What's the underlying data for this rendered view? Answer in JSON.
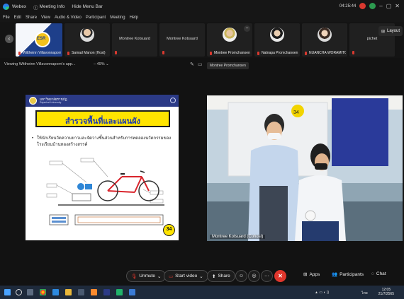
{
  "titlebar": {
    "app": "Webex",
    "meeting_info": "Meeting Info",
    "menu_toggle": "Hide Menu Bar",
    "time": "04:25:44"
  },
  "menu": {
    "items": [
      "File",
      "Edit",
      "Share",
      "View",
      "Audio & Video",
      "Participant",
      "Meeting",
      "Help"
    ]
  },
  "participants": [
    {
      "name": "Wittheinn Villavonnaporn",
      "kind": "presenter"
    },
    {
      "name": "Samad Manon (Host)",
      "kind": "avatar"
    },
    {
      "name": "Montree Kotsuard",
      "kind": "name"
    },
    {
      "name": "Montree Kotsuard",
      "kind": "name"
    },
    {
      "name": "Montree Promchanoen",
      "kind": "avatar"
    },
    {
      "name": "Natnapa Promchanoen",
      "kind": "avatar"
    },
    {
      "name": "NUANCHA WORAMITO...",
      "kind": "avatar"
    },
    {
      "name": "pichet",
      "kind": "name"
    }
  ],
  "layout_button": "Layout",
  "viewing": {
    "label": "Viewing Wittheinn Villavonnaporn's app...",
    "zoom": "49%",
    "presenter_tag": "Montree Promchanoen"
  },
  "slide": {
    "university": "มหาวิทยาลัยราชภัฏ",
    "subtitle": "Rajabhat University",
    "title": "สำรวจพื้นที่และแผนผัง",
    "bullet": "ให้นักเรียนวัดความยาวและจัดวางชิ้นส่วนสำหรับการทดลองนวัตกรรมของโรงเรียนบ้านทองสร้างสรรค์",
    "page_number": "34"
  },
  "video": {
    "caption": "Montree Kotsuard (Cohost)",
    "board_number": "34"
  },
  "controls": {
    "unmute": "Unmute",
    "start_video": "Start video",
    "share": "Share",
    "apps": "Apps",
    "participants": "Participants",
    "chat": "Chat"
  },
  "taskbar": {
    "time": "12:05",
    "date": "21/7/2565",
    "lang": "ไทย"
  },
  "colors": {
    "leave": "#e0362c",
    "slide_header": "#2b3a86",
    "slide_title_fill": "#ffe400",
    "mic_muted": "#d9392f"
  }
}
